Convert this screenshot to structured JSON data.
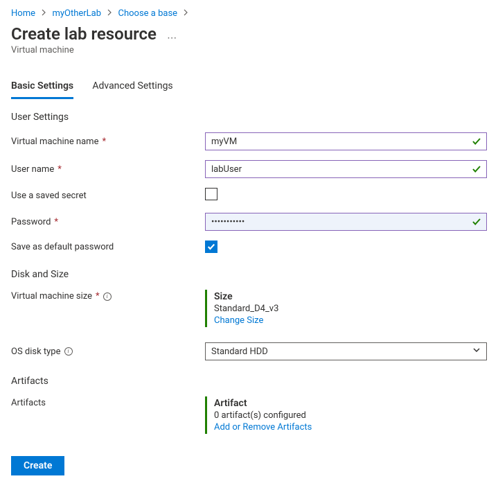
{
  "breadcrumb": {
    "items": [
      {
        "label": "Home"
      },
      {
        "label": "myOtherLab"
      },
      {
        "label": "Choose a base"
      }
    ]
  },
  "header": {
    "title": "Create lab resource",
    "subtitle": "Virtual machine"
  },
  "tabs": {
    "basic": "Basic Settings",
    "advanced": "Advanced Settings"
  },
  "sections": {
    "user": "User Settings",
    "disk": "Disk and Size",
    "artifacts": "Artifacts"
  },
  "fields": {
    "vmNameLabel": "Virtual machine name",
    "vmNameValue": "myVM",
    "userNameLabel": "User name",
    "userNameValue": "labUser",
    "savedSecretLabel": "Use a saved secret",
    "passwordLabel": "Password",
    "passwordValue": "•••••••••••",
    "saveDefaultLabel": "Save as default password",
    "vmSizeLabel": "Virtual machine size",
    "osDiskLabel": "OS disk type",
    "osDiskValue": "Standard HDD",
    "artifactsLabel": "Artifacts"
  },
  "sizeCard": {
    "title": "Size",
    "value": "Standard_D4_v3",
    "link": "Change Size"
  },
  "artifactCard": {
    "title": "Artifact",
    "value": "0 artifact(s) configured",
    "link": "Add or Remove Artifacts"
  },
  "buttons": {
    "create": "Create"
  }
}
